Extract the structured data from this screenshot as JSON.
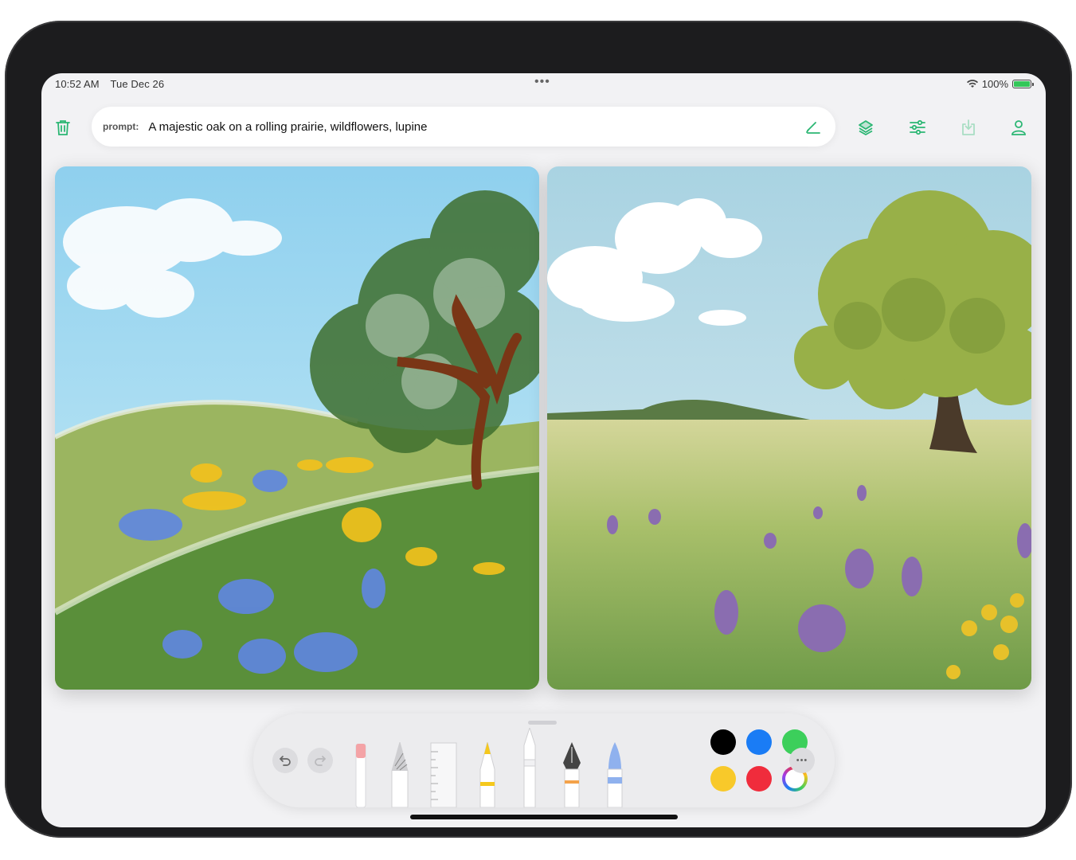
{
  "status_bar": {
    "time": "10:52 AM",
    "date": "Tue Dec 26",
    "battery": "100%",
    "multitask_dots": "•••"
  },
  "toolbar": {
    "delete_icon": "trash-icon",
    "prompt_label": "prompt:",
    "prompt_value": "A majestic oak on a rolling prairie, wildflowers, lupine",
    "edit_icon": "pencil-edit-icon",
    "actions": [
      "layers-icon",
      "sliders-icon",
      "download-icon",
      "profile-icon"
    ],
    "accent_color": "#2bb673"
  },
  "canvases": {
    "left": "hand-drawn sketch",
    "right": "generated image"
  },
  "palette": {
    "undo_icon": "undo-icon",
    "redo_icon": "redo-icon",
    "tools": [
      "eraser",
      "pencil",
      "ruler",
      "marker",
      "crayon",
      "fountain-pen",
      "watercolor-brush"
    ],
    "colors": [
      "#000000",
      "#1a7cf5",
      "#3ccf5b",
      "#f8c92a",
      "#f02c3c"
    ],
    "color_picker_icon": "color-wheel-icon",
    "more_icon": "more-icon",
    "more_glyph": "•••"
  }
}
